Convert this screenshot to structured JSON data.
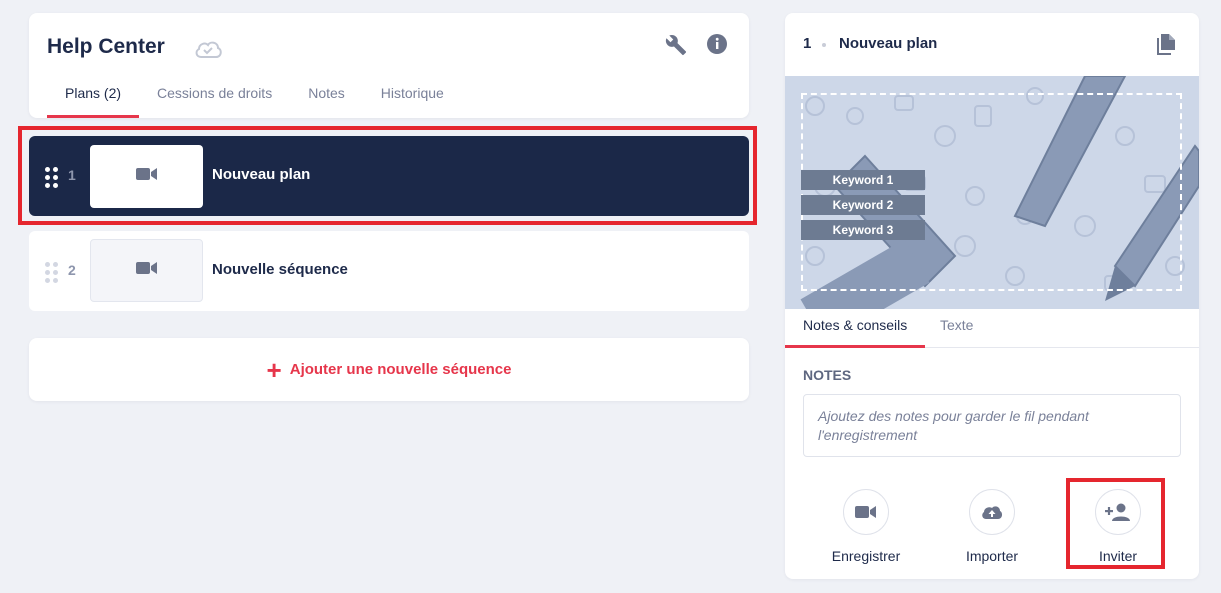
{
  "header": {
    "title": "Help Center",
    "tabs": [
      {
        "label": "Plans (2)",
        "active": true
      },
      {
        "label": "Cessions de droits",
        "active": false
      },
      {
        "label": "Notes",
        "active": false
      },
      {
        "label": "Historique",
        "active": false
      }
    ]
  },
  "rows": [
    {
      "number": "1",
      "title": "Nouveau plan",
      "selected": true
    },
    {
      "number": "2",
      "title": "Nouvelle séquence",
      "selected": false
    }
  ],
  "add_sequence": {
    "icon": "+",
    "label": "Ajouter une nouvelle séquence"
  },
  "right_panel": {
    "number": "1",
    "title": "Nouveau plan",
    "keywords": [
      "Keyword 1",
      "Keyword 2",
      "Keyword 3"
    ],
    "tabs": [
      {
        "label": "Notes & conseils",
        "active": true
      },
      {
        "label": "Texte",
        "active": false
      }
    ],
    "notes_heading": "NOTES",
    "notes_placeholder": "Ajoutez des notes pour garder le fil pendant l'enregistrement",
    "actions": [
      {
        "label": "Enregistrer",
        "icon": "video-camera-icon"
      },
      {
        "label": "Importer",
        "icon": "cloud-upload-icon"
      },
      {
        "label": "Inviter",
        "icon": "add-person-icon"
      }
    ]
  },
  "colors": {
    "accent": "#e6364b",
    "dark": "#1b2848",
    "highlight": "#e5262e"
  }
}
